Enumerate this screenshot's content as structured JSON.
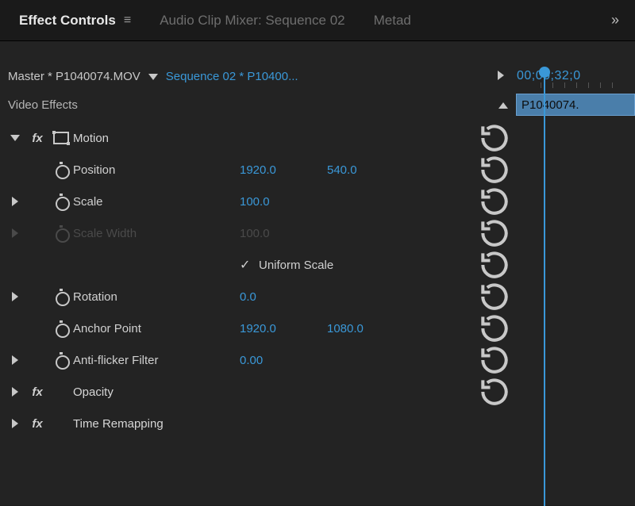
{
  "tabs": {
    "effect_controls": "Effect Controls",
    "audio_mixer": "Audio Clip Mixer: Sequence 02",
    "metadata": "Metad"
  },
  "source": {
    "master": "Master * P1040074.MOV",
    "sequence": "Sequence 02 * P10400...",
    "playhead_time": "00;00;32;0"
  },
  "section": {
    "title": "Video Effects",
    "clip_name": "P1040074."
  },
  "motion": {
    "label": "Motion",
    "position": {
      "label": "Position",
      "x": "1920.0",
      "y": "540.0"
    },
    "scale": {
      "label": "Scale",
      "value": "100.0"
    },
    "scale_width": {
      "label": "Scale Width",
      "value": "100.0"
    },
    "uniform": {
      "label": "Uniform Scale"
    },
    "rotation": {
      "label": "Rotation",
      "value": "0.0"
    },
    "anchor": {
      "label": "Anchor Point",
      "x": "1920.0",
      "y": "1080.0"
    },
    "antiflicker": {
      "label": "Anti-flicker Filter",
      "value": "0.00"
    }
  },
  "opacity": {
    "label": "Opacity"
  },
  "time_remap": {
    "label": "Time Remapping"
  }
}
